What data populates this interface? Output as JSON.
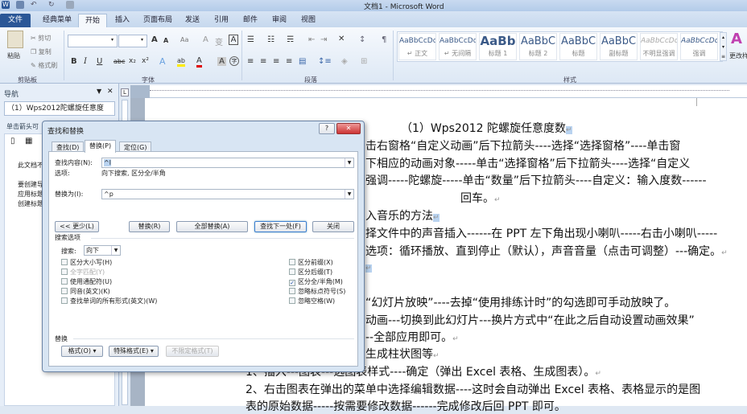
{
  "window": {
    "title": "文档1 - Microsoft Word",
    "app_icon": "W"
  },
  "tabs": [
    "文件",
    "经典菜单",
    "开始",
    "插入",
    "页面布局",
    "发送",
    "引用",
    "邮件",
    "审阅",
    "视图"
  ],
  "ribbon": {
    "clipboard": {
      "label": "剪贴板",
      "paste": "粘贴",
      "cut": "剪切",
      "copy": "复制",
      "format_painter": "格式刷"
    },
    "font": {
      "label": "字体",
      "bold": "B",
      "italic": "I",
      "underline": "U",
      "strike": "abc",
      "sub": "x₂",
      "sup": "x²",
      "grow": "A",
      "shrink": "A",
      "case": "Aa",
      "clear": "A",
      "char_border": "A",
      "text_effect": "A",
      "highlight": "ab",
      "font_color": "A",
      "char_shade": "A",
      "enclose": "字",
      "phonetic": "变"
    },
    "paragraph": {
      "label": "段落"
    },
    "styles": {
      "label": "样式",
      "items": [
        {
          "preview": "AaBbCcDd",
          "name": "↵ 正文"
        },
        {
          "preview": "AaBbCcDd",
          "name": "↵ 无间隔"
        },
        {
          "preview": "AaBb",
          "name": "标题 1"
        },
        {
          "preview": "AaBbC",
          "name": "标题 2"
        },
        {
          "preview": "AaBbC",
          "name": "标题"
        },
        {
          "preview": "AaBbC",
          "name": "副标题"
        },
        {
          "preview": "AaBbCcDd",
          "name": "不明显强调"
        },
        {
          "preview": "AaBbCcDd",
          "name": "强调"
        }
      ],
      "change": "更改样"
    }
  },
  "nav": {
    "title": "导航",
    "search": "（1）Wps2012陀螺旋任意度",
    "hint": "单击箭头可",
    "l1": "此文档不",
    "l2": "要创建导",
    "l3": "应用标题",
    "l4": "创建标题"
  },
  "document": {
    "lines": [
      "（1）Wps2012 陀螺旋任意度数",
      "击右窗格“自定义动画”后下拉箭头----选择“选择窗格”----单击窗",
      "下相应的动画对象-----单击“选择窗格”后下拉箭头----选择“自定义",
      "强调-----陀螺旋-----单击“数量”后下拉箭头----自定义：输入度数------",
      "回车。",
      "入音乐的方法",
      "择文件中的声音插入------在 PPT 左下角出现小喇叭-----右击小喇叭-----",
      "选项：循环播放、直到停止（默认），声音音量（点击可调整）---确定。",
      "“幻灯片放映”----去掉“使用排练计时”的勾选即可手动放映了。",
      "动画---切换到此幻灯片---换片方式中“在此之后自动设置动画效果”",
      "--全部应用即可。",
      "生成柱状图等",
      "1、插入---图表---选图表样式----确定（弹出 Excel 表格、生成图表）。",
      "2、右击图表在弹出的菜单中选择编辑数据----这时会自动弹出 Excel 表格、表格显示的是图",
      "表的原始数据-----按需要修改数据------完成修改后回 PPT 即可。"
    ],
    "para_mark": "↵"
  },
  "dialog": {
    "title": "查找和替换",
    "tabs": [
      "查找(D)",
      "替换(P)",
      "定位(G)"
    ],
    "find_label": "查找内容(N):",
    "find_value": "^l",
    "options_label": "选项:",
    "options_value": "向下搜索, 区分全/半角",
    "replace_label": "替换为(I):",
    "replace_value": "^p",
    "buttons": {
      "less": "<< 更少(L)",
      "replace": "替换(R)",
      "replace_all": "全部替换(A)",
      "find_next": "查找下一处(F)",
      "close": "关闭"
    },
    "search_options": "搜索选项",
    "search_label": "搜索:",
    "search_dir": "向下",
    "left_checks": [
      {
        "label": "区分大小写(H)",
        "checked": false
      },
      {
        "label": "全字匹配(Y)",
        "checked": false,
        "disabled": true
      },
      {
        "label": "使用通配符(U)",
        "checked": false
      },
      {
        "label": "同音(英文)(K)",
        "checked": false
      },
      {
        "label": "查找单词的所有形式(英文)(W)",
        "checked": false
      }
    ],
    "right_checks": [
      {
        "label": "区分前缀(X)",
        "checked": false
      },
      {
        "label": "区分后缀(T)",
        "checked": false
      },
      {
        "label": "区分全/半角(M)",
        "checked": true
      },
      {
        "label": "忽略标点符号(S)",
        "checked": false
      },
      {
        "label": "忽略空格(W)",
        "checked": false
      }
    ],
    "replace_section": "替换",
    "format": "格式(O) ▾",
    "special": "特殊格式(E) ▾",
    "no_format": "不限定格式(T)",
    "help": "?",
    "close_x": "✕"
  }
}
